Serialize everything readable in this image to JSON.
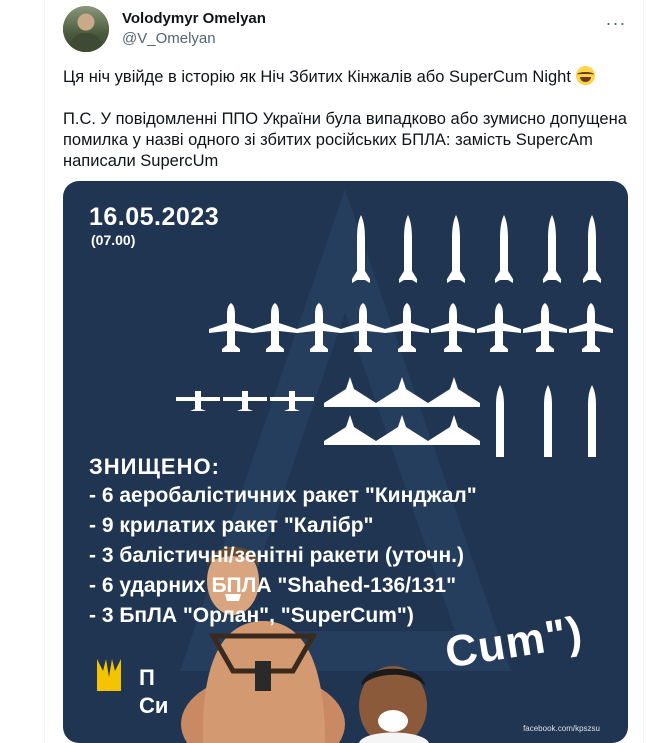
{
  "author": {
    "display_name": "Volodymyr Omelyan",
    "handle": "@V_Omelyan"
  },
  "tweet": {
    "line1": "Ця ніч увійде в історію як Ніч Збитих Кінжалів або SuperCum Night",
    "line2": "П.С. У повідомленні ППО України була випадково або зумисно допущена помилка у назві одного зі збитих російських БПЛА: замість SupercAm написали SupercUm"
  },
  "infographic": {
    "date": "16.05.2023",
    "time": "(07.00)",
    "title": "ЗНИЩЕНО:",
    "items": [
      "- 6 аеробалістичних  ракет  \"Кинджал\"",
      "- 9 крилатих ракет \"Калібр\"",
      "- 3 балістичні/зенітні ракети (уточн.)",
      "- 6 ударних БПЛА \"Shahed-136/131\"",
      "- 3 БпЛА \"Орлан\", \"SuperCum\")"
    ],
    "bottom_left_1": "П",
    "bottom_left_2": "Си",
    "cum_text": "Cum\")",
    "footer": "facebook.com/kpszsu"
  },
  "colors": {
    "panel": "#1f3552",
    "white": "#ffffff",
    "trident": "#f5c400"
  },
  "icons": {
    "more": "more-horizontal-icon",
    "emoji": "face-with-tears-of-joy-icon",
    "trident": "trident-icon"
  }
}
